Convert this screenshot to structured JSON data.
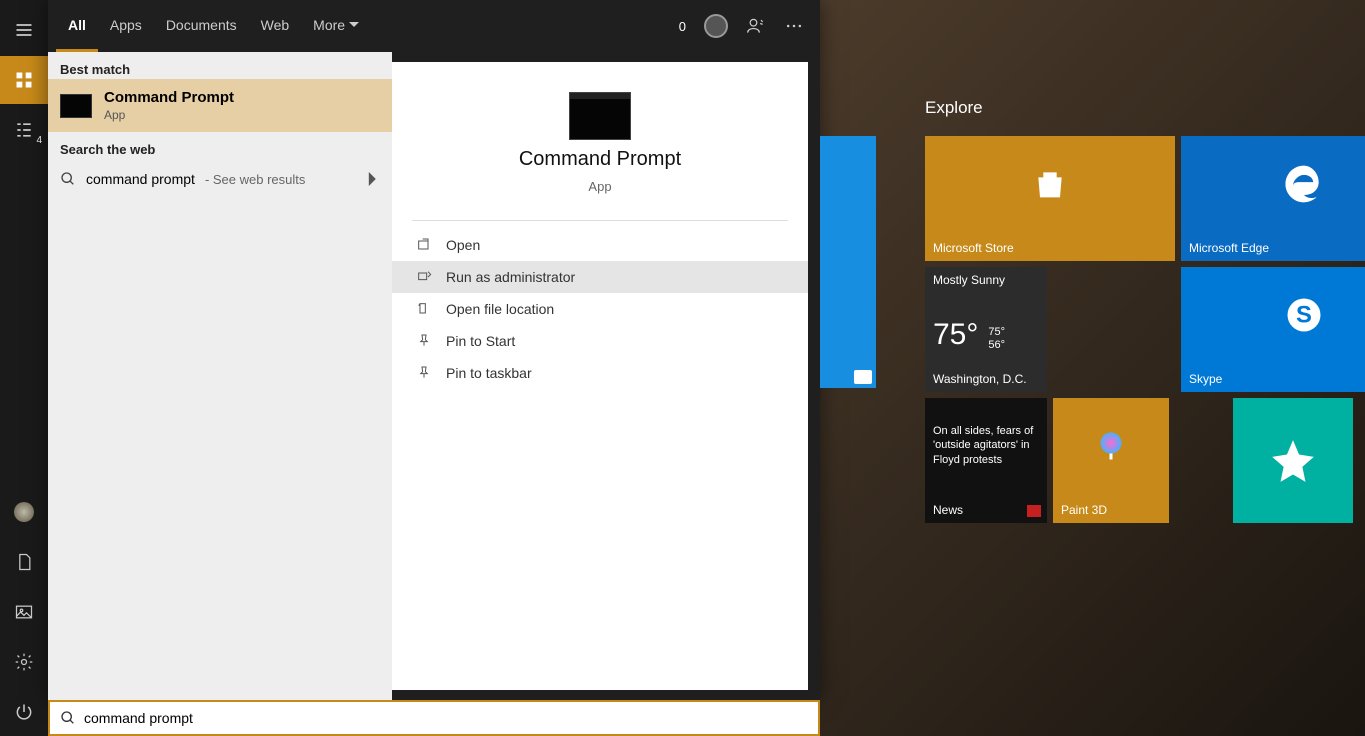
{
  "tabs": {
    "all": "All",
    "apps": "Apps",
    "documents": "Documents",
    "web": "Web",
    "more": "More",
    "score": "0"
  },
  "sections": {
    "best": "Best match",
    "web": "Search the web"
  },
  "best": {
    "title": "Command Prompt",
    "sub": "App"
  },
  "webRow": {
    "query": "command prompt",
    "sub": " - See web results"
  },
  "preview": {
    "title": "Command Prompt",
    "kind": "App"
  },
  "actions": {
    "open": "Open",
    "admin": "Run as administrator",
    "loc": "Open file location",
    "pinStart": "Pin to Start",
    "pinTask": "Pin to taskbar"
  },
  "explore": "Explore",
  "tiles": {
    "store": "Microsoft Store",
    "edge": "Microsoft Edge",
    "skype": "Skype",
    "weather": {
      "cond": "Mostly Sunny",
      "temp": "75°",
      "hi": "75°",
      "lo": "56°",
      "city": "Washington, D.C."
    },
    "news": {
      "headline": "On all sides, fears of 'outside agitators' in Floyd protests",
      "label": "News"
    },
    "paint": "Paint 3D"
  },
  "search": {
    "value": "command prompt"
  }
}
